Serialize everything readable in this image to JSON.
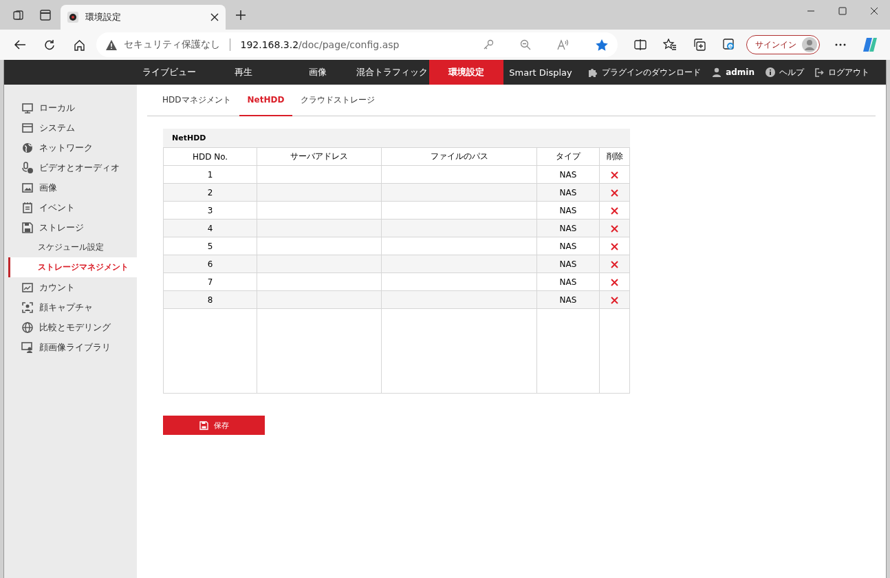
{
  "browser": {
    "tab_title": "環境設定",
    "security_label": "セキュリティ保護なし",
    "url_host": "192.168.3.2",
    "url_path": "/doc/page/config.asp",
    "signin": "サインイン"
  },
  "top_nav": {
    "items": [
      {
        "label": "ライブビュー",
        "selected": false
      },
      {
        "label": "再生",
        "selected": false
      },
      {
        "label": "画像",
        "selected": false
      },
      {
        "label": "混合トラフィック",
        "selected": false
      },
      {
        "label": "環境設定",
        "selected": true
      },
      {
        "label": "Smart Display",
        "selected": false
      }
    ],
    "right_items": [
      {
        "kind": "plugin",
        "label": "プラグインのダウンロード"
      },
      {
        "kind": "user",
        "label": "admin"
      },
      {
        "kind": "help",
        "label": "ヘルプ"
      },
      {
        "kind": "logout",
        "label": "ログアウト"
      }
    ]
  },
  "sidebar": {
    "items": [
      {
        "label": "ローカル",
        "selected": false
      },
      {
        "label": "システム",
        "selected": false
      },
      {
        "label": "ネットワーク",
        "selected": false
      },
      {
        "label": "ビデオとオーディオ",
        "selected": false
      },
      {
        "label": "画像",
        "selected": false
      },
      {
        "label": "イベント",
        "selected": false
      },
      {
        "label": "ストレージ",
        "selected": false,
        "children": [
          {
            "label": "スケジュール設定",
            "selected": false
          },
          {
            "label": "ストレージマネジメント",
            "selected": true
          }
        ]
      },
      {
        "label": "カウント",
        "selected": false
      },
      {
        "label": "顔キャプチャ",
        "selected": false
      },
      {
        "label": "比較とモデリング",
        "selected": false
      },
      {
        "label": "顔画像ライブラリ",
        "selected": false
      }
    ]
  },
  "tabs": [
    {
      "label": "HDDマネジメント",
      "selected": false
    },
    {
      "label": "NetHDD",
      "selected": true
    },
    {
      "label": "クラウドストレージ",
      "selected": false
    }
  ],
  "table": {
    "title": "NetHDD",
    "columns": [
      "HDD No.",
      "サーバアドレス",
      "ファイルのパス",
      "タイプ",
      "削除"
    ],
    "rows": [
      {
        "hdd_no": "1",
        "type": "NAS"
      },
      {
        "hdd_no": "2",
        "type": "NAS"
      },
      {
        "hdd_no": "3",
        "type": "NAS"
      },
      {
        "hdd_no": "4",
        "type": "NAS"
      },
      {
        "hdd_no": "5",
        "type": "NAS"
      },
      {
        "hdd_no": "6",
        "type": "NAS"
      },
      {
        "hdd_no": "7",
        "type": "NAS"
      },
      {
        "hdd_no": "8",
        "type": "NAS"
      }
    ]
  },
  "save_button": "保存"
}
